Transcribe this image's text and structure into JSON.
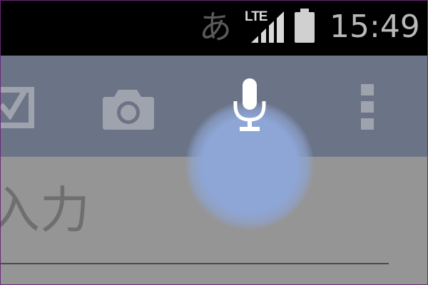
{
  "status_bar": {
    "ime_indicator": "あ",
    "network_type": "LTE",
    "signal_icon": "signal-strength-icon",
    "battery_icon": "battery-icon",
    "time": "15:49"
  },
  "action_bar": {
    "background": "#6b7386",
    "active_accent": "#8ea6d6",
    "items": [
      {
        "name": "checkbox",
        "icon": "checkbox-checked-icon"
      },
      {
        "name": "camera",
        "icon": "camera-icon"
      },
      {
        "name": "voice-input",
        "icon": "microphone-icon",
        "state": "pressed"
      },
      {
        "name": "overflow-menu",
        "icon": "more-vertical-icon"
      }
    ]
  },
  "editor": {
    "hint_text": "入力"
  }
}
